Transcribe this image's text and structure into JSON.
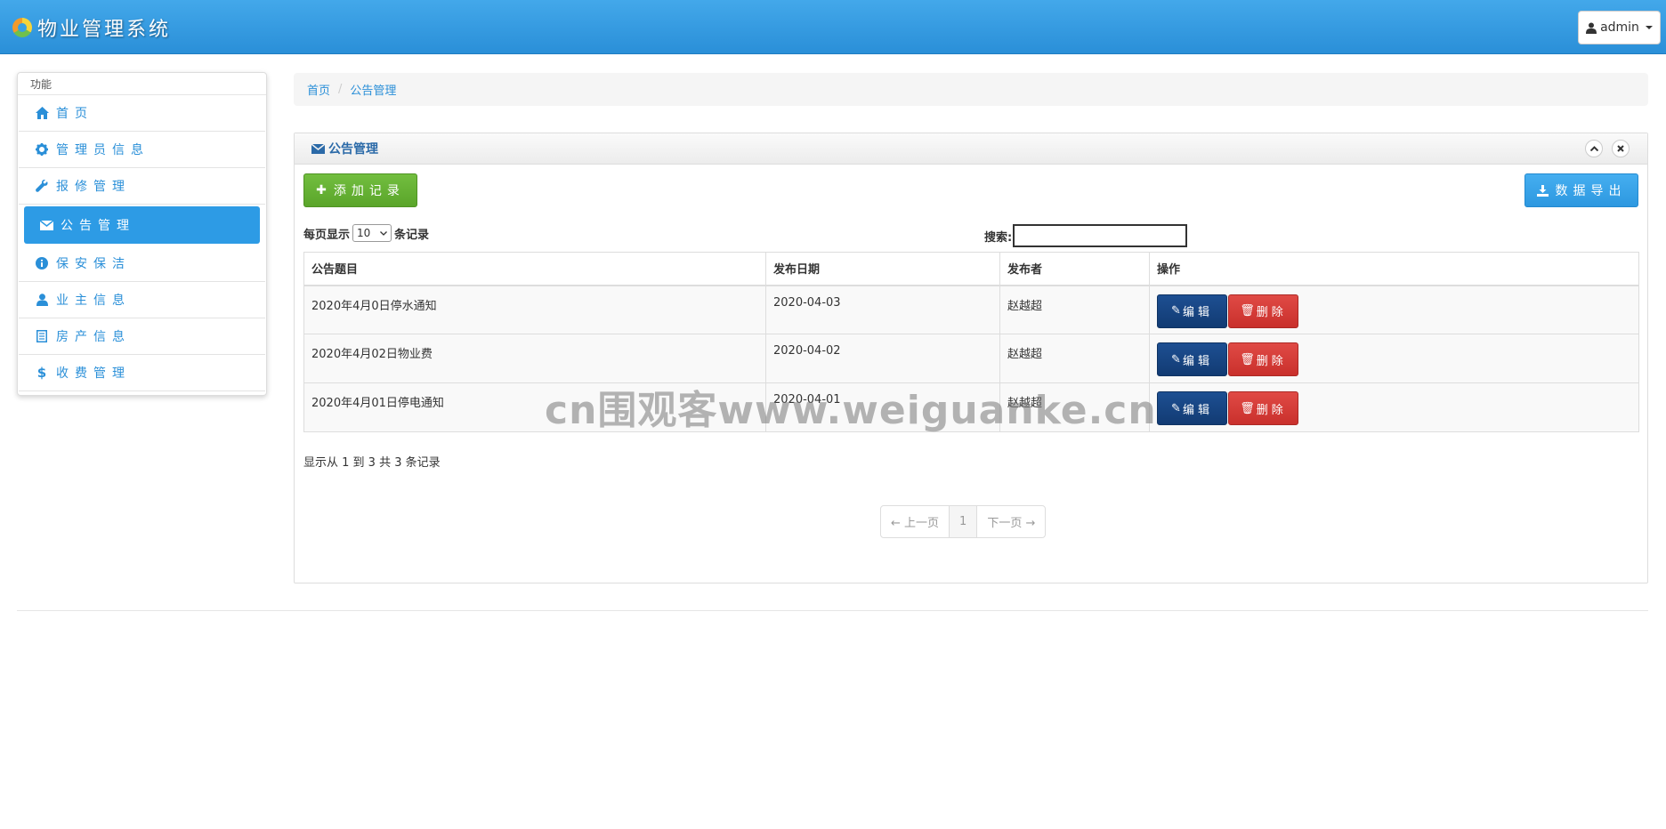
{
  "app": {
    "title": "物业管理系统",
    "user": "admin"
  },
  "sidebar": {
    "heading": "功能",
    "items": [
      {
        "label": "首页",
        "icon": "home-icon",
        "active": false
      },
      {
        "label": "管理员信息",
        "icon": "gear-icon",
        "active": false
      },
      {
        "label": "报修管理",
        "icon": "wrench-icon",
        "active": false
      },
      {
        "label": "公告管理",
        "icon": "envelope-icon",
        "active": true
      },
      {
        "label": "保安保洁",
        "icon": "info-circle-icon",
        "active": false
      },
      {
        "label": "业主信息",
        "icon": "user-icon",
        "active": false
      },
      {
        "label": "房产信息",
        "icon": "list-icon",
        "active": false
      },
      {
        "label": "收费管理",
        "icon": "dollar-icon",
        "active": false
      }
    ]
  },
  "breadcrumb": {
    "home": "首页",
    "current": "公告管理"
  },
  "panel": {
    "title": "公告管理",
    "add_label": "添加记录",
    "export_label": "数据导出"
  },
  "table_controls": {
    "length_prefix": "每页显示",
    "length_value": "10",
    "length_suffix": "条记录",
    "search_label": "搜索:",
    "search_value": ""
  },
  "table": {
    "columns": [
      "公告题目",
      "发布日期",
      "发布者",
      "操作"
    ],
    "rows": [
      {
        "title": "2020年4月0日停水通知",
        "date": "2020-04-03",
        "author": "赵越超"
      },
      {
        "title": "2020年4月02日物业费",
        "date": "2020-04-02",
        "author": "赵越超"
      },
      {
        "title": "2020年4月01日停电通知",
        "date": "2020-04-01",
        "author": "赵越超"
      }
    ],
    "edit_label": "编辑",
    "delete_label": "删除"
  },
  "info_text": "显示从 1 到 3 共 3 条记录",
  "pagination": {
    "prev": "← 上一页",
    "current": "1",
    "next": "下一页 →"
  },
  "watermark": "cn围观客www.weiguanke.cn",
  "colors": {
    "header": "#2a8fd8",
    "active_nav": "#2d9be5",
    "add": "#5aa52a",
    "export": "#2d98e0",
    "edit": "#123b73",
    "delete": "#c9302c"
  }
}
